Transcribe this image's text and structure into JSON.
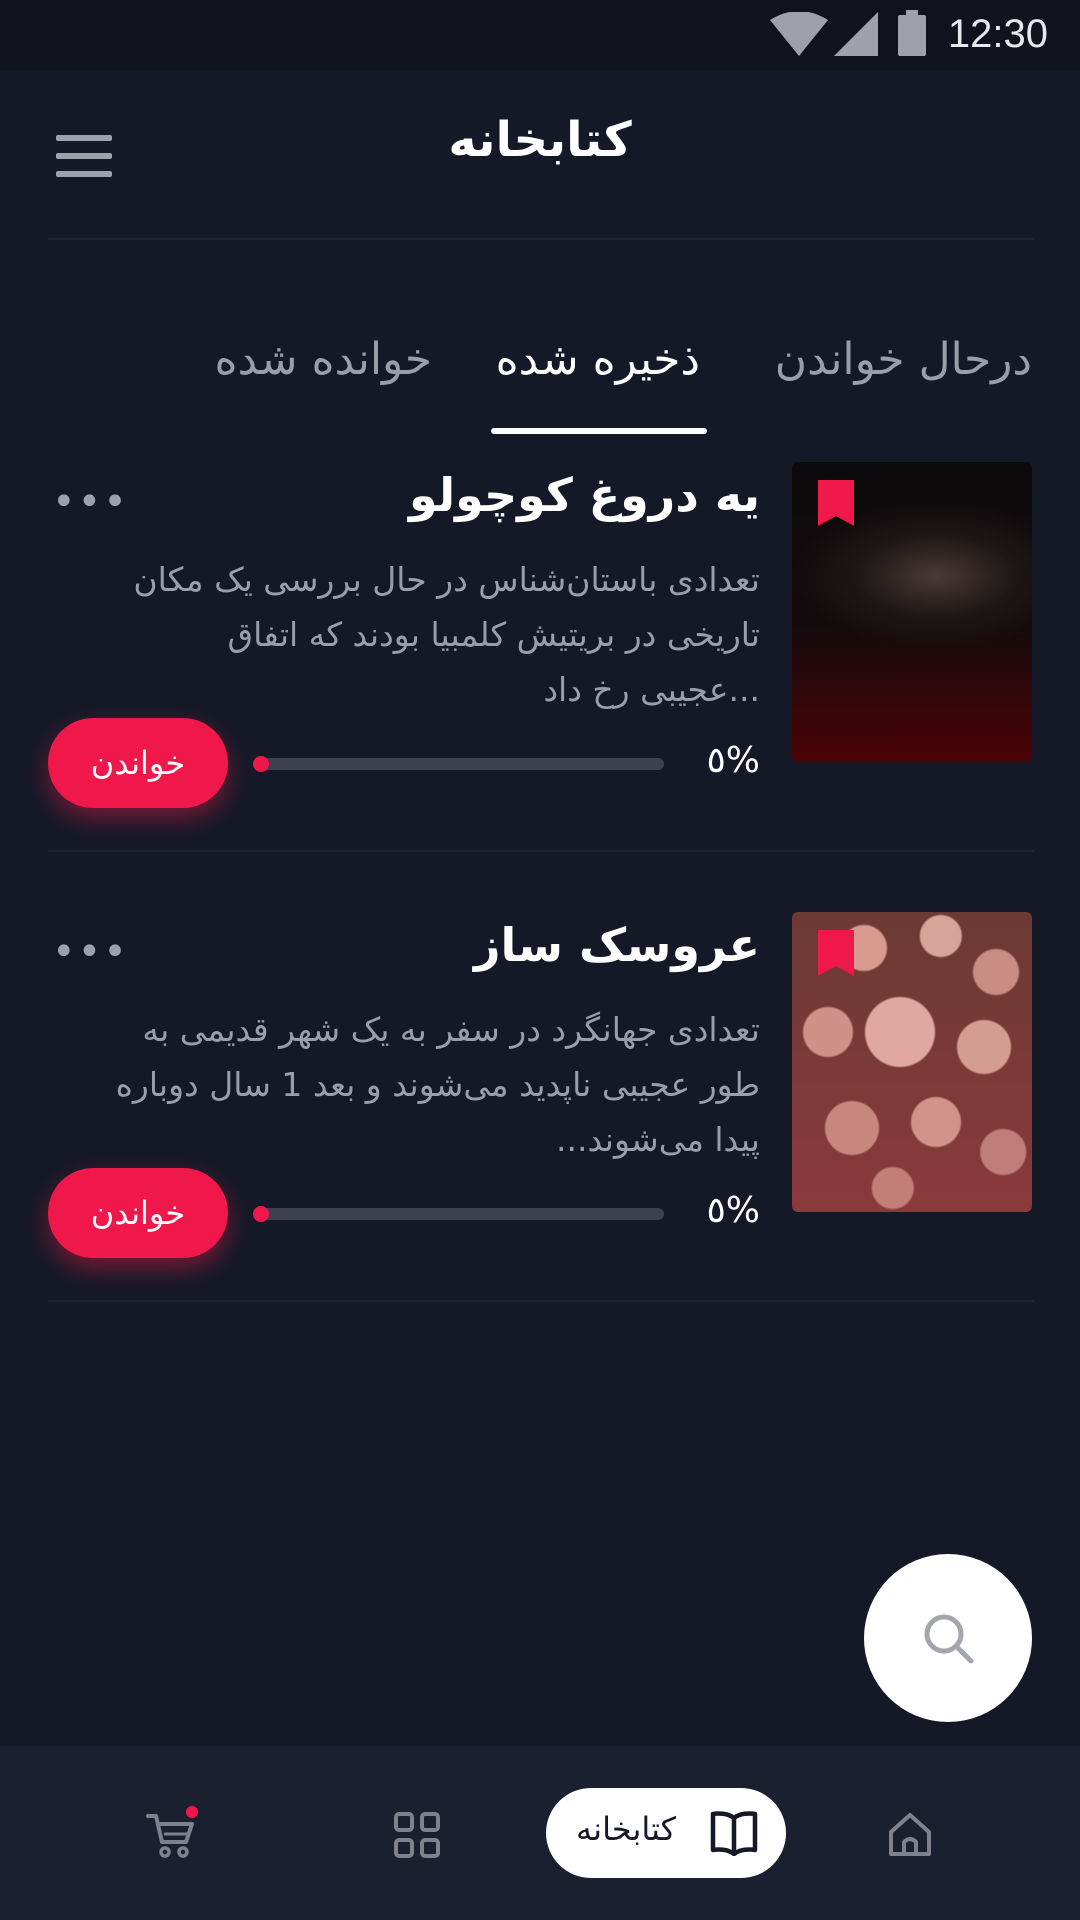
{
  "status_bar": {
    "time": "12:30"
  },
  "header": {
    "title": "کتابخانه"
  },
  "tabs": [
    {
      "label": "درحال خواندن",
      "active": false
    },
    {
      "label": "ذخیره شده",
      "active": true
    },
    {
      "label": "خوانده شده",
      "active": false
    }
  ],
  "books": [
    {
      "title": "یه دروغ کوچولو",
      "description": "تعدادی باستان‌شناس در حال بررسی یک مکان تاریخی در بریتیش کلمبیا بودند که اتفاق ...عجیبی رخ داد",
      "progress_label": "٥%",
      "progress": 0.0,
      "read_label": "خواندن",
      "bookmarked": true
    },
    {
      "title": "عروسک ساز",
      "description": "تعدادی جهانگرد در سفر به یک شهر قدیمی به طور عجیبی ناپدید می‌شوند و بعد 1 سال دوباره پیدا می‌شوند...",
      "progress_label": "٥%",
      "progress": 0.0,
      "read_label": "خواندن",
      "bookmarked": true
    }
  ],
  "bottom_nav": {
    "items": [
      {
        "icon": "home-icon",
        "label": ""
      },
      {
        "icon": "book-open-icon",
        "label": "کتابخانه",
        "active": true
      },
      {
        "icon": "grid-icon",
        "label": ""
      },
      {
        "icon": "cart-icon",
        "label": ""
      }
    ]
  },
  "colors": {
    "accent": "#f0184a",
    "background": "#151927",
    "nav": "#1b2030"
  }
}
